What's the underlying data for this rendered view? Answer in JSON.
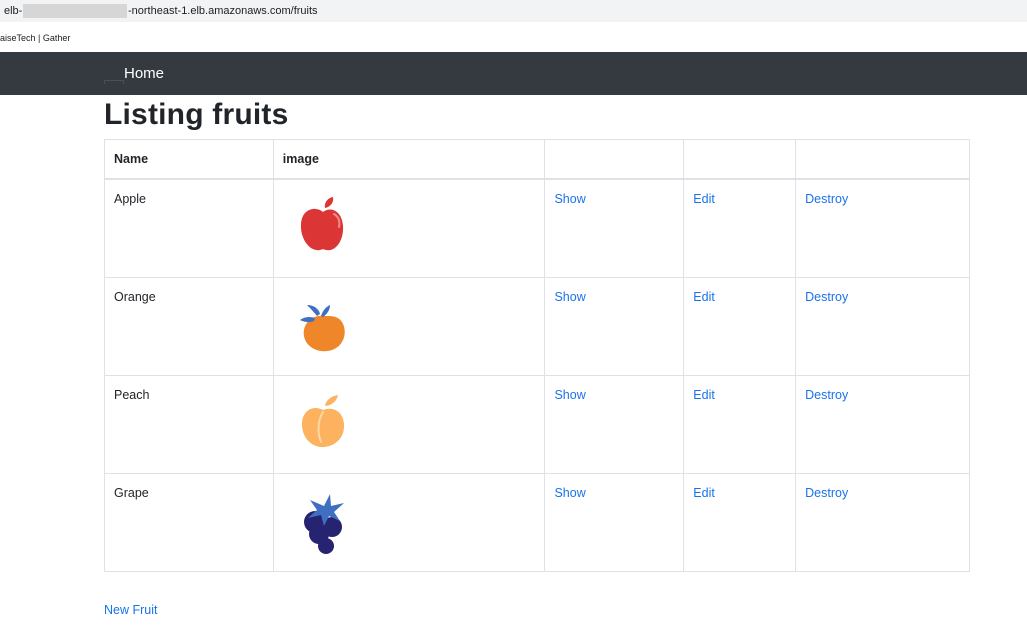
{
  "browser": {
    "url_prefix": "elb-",
    "url_suffix": "-northeast-1.elb.amazonaws.com/fruits",
    "bookmark": "aiseTech | Gather"
  },
  "nav": {
    "home_label": "Home"
  },
  "page": {
    "title": "Listing fruits",
    "new_link": "New Fruit"
  },
  "table": {
    "headers": {
      "name": "Name",
      "image": "image"
    },
    "actions": {
      "show": "Show",
      "edit": "Edit",
      "destroy": "Destroy"
    },
    "rows": [
      {
        "name": "Apple",
        "icon": "apple-icon",
        "color": "#dc3535"
      },
      {
        "name": "Orange",
        "icon": "orange-icon",
        "color": "#f0862a"
      },
      {
        "name": "Peach",
        "icon": "peach-icon",
        "color": "#fdb260"
      },
      {
        "name": "Grape",
        "icon": "grape-icon",
        "color": "#262470"
      }
    ]
  },
  "colors": {
    "navbar": "#343a40",
    "link": "#1a73e8",
    "grape_leaf": "#3f6fc1"
  }
}
